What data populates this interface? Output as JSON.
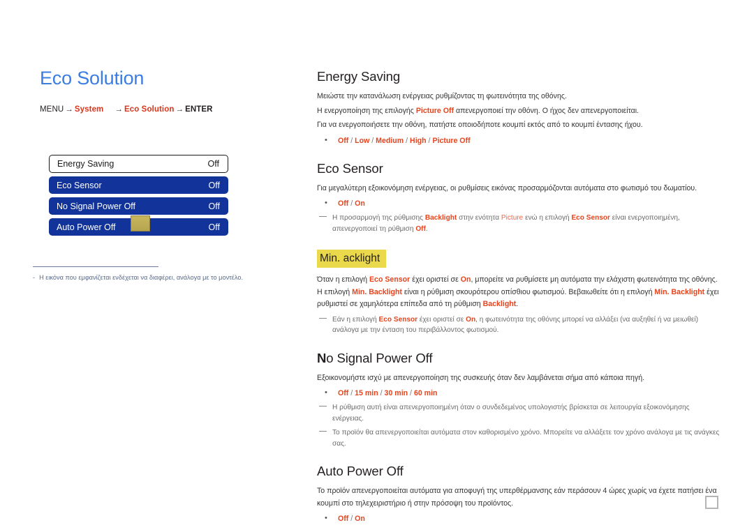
{
  "page": {
    "title": "Eco Solution"
  },
  "breadcrumb": {
    "menu": "MENU",
    "arrow": "→",
    "system": "System",
    "eco_solution": "Eco Solution",
    "enter": "ENTER"
  },
  "osd": {
    "rows": [
      {
        "label": "Energy Saving",
        "value": "Off",
        "selected": false
      },
      {
        "label": "Eco Sensor",
        "value": "Off",
        "selected": true
      },
      {
        "label": "No Signal Power Off",
        "value": "Off",
        "selected": true
      },
      {
        "label": "Auto Power Off",
        "value": "Off",
        "selected": true
      }
    ],
    "marker_color": "#c0ae55"
  },
  "left_note": {
    "dash": "-",
    "text": "Η εικόνα που εμφανίζεται ενδέχεται να διαφέρει, ανάλογα με το μοντέλο."
  },
  "sections": {
    "energy_saving": {
      "title": "Energy Saving",
      "p1": "Μειώστε την κατανάλωση ενέργειας ρυθμίζοντας τη φωτεινότητα της οθόνης.",
      "p2_a": "Η ενεργοποίηση της επιλογής ",
      "p2_hl": "Picture Off",
      "p2_b": " απενεργοποιεί την οθόνη. Ο ήχος δεν απενεργοποιείται.",
      "p3": "Για να ενεργοποιήσετε την οθόνη, πατήστε οποιοδήποτε κουμπί εκτός από το κουμπί έντασης ήχου.",
      "options": [
        "Off",
        "Low",
        "Medium",
        "High",
        "Picture Off"
      ]
    },
    "eco_sensor": {
      "title": "Eco Sensor",
      "p1": "Για μεγαλύτερη εξοικονόμηση ενέργειας, οι ρυθμίσεις εικόνας προσαρμόζονται αυτόματα στο φωτισμό του δωματίου.",
      "options": [
        "Off",
        "On"
      ],
      "note_a": "Η προσαρμογή της ρύθμισης ",
      "note_hl1": "Backlight",
      "note_b": " στην ενότητα ",
      "note_hl2": "Picture",
      "note_c": "  ενώ η επιλογή ",
      "note_hl3": "Eco Sensor",
      "note_d": " είναι ενεργοποιημένη, απενεργοποιεί τη ρύθμιση ",
      "note_hl4": "Off",
      "note_e": "."
    },
    "min_backlight": {
      "heading": "Min. acklight",
      "heading_bg": "#e9d94b",
      "p_a": "Όταν η επιλογή ",
      "p_hl1": "Eco Sensor",
      "p_b": " έχει οριστεί σε ",
      "p_hl2": "On",
      "p_c": ", μπορείτε να ρυθμίσετε μη αυτόματα την ελάχιστη φωτεινότητα της οθόνης. Η επιλογή ",
      "p_hl3": "Min. Backlight",
      "p_d": " είναι η ρύθμιση σκουρότερου οπίσθιου φωτισμού. Βεβαιωθείτε ότι η επιλογή ",
      "p_hl4": "Min. Backlight",
      "p_e": " έχει ρυθμιστεί σε χαμηλότερα επίπεδα από τη ρύθμιση ",
      "p_hl5": "Backlight",
      "p_f": ".",
      "note_a": "Εάν η επιλογή ",
      "note_hl1": "Eco Sensor",
      "note_b": " έχει οριστεί σε ",
      "note_hl2": "On",
      "note_c": ", η φωτεινότητα της οθόνης μπορεί να αλλάξει (να αυξηθεί ή να μειωθεί) ανάλογα με την ένταση του περιβάλλοντος φωτισμού."
    },
    "no_signal_power_off": {
      "title_cap": "N",
      "title_rest": "o Signal Power Off",
      "p1": "Εξοικονομήστε ισχύ με απενεργοποίηση της συσκευής όταν δεν λαμβάνεται σήμα από κάποια πηγή.",
      "options": [
        "Off",
        "15 min",
        "30 min",
        "60 min"
      ],
      "note1": "Η ρύθμιση αυτή είναι απενεργοποιημένη όταν ο συνδεδεμένος υπολογιστής βρίσκεται σε λειτουργία εξοικονόμησης ενέργειας.",
      "note2": "Το προϊόν θα απενεργοποιείται αυτόματα στον καθορισμένο χρόνο. Μπορείτε να αλλάξετε τον χρόνο ανάλογα με τις ανάγκες σας."
    },
    "auto_power_off": {
      "title": "Auto Power Off",
      "p1": "Το προϊόν απενεργοποιείται αυτόματα για αποφυγή της υπερθέρμανσης εάν περάσουν 4 ώρες χωρίς να έχετε πατήσει ένα κουμπί στο τηλεχειριστήριο ή στην πρόσοψη του προϊόντος.",
      "options": [
        "Off",
        "On"
      ]
    }
  },
  "colors": {
    "title_blue": "#3b7de0",
    "accent_red": "#e8431c",
    "menu_blue": "#12349a",
    "highlight_yellow": "#e9d94b"
  }
}
